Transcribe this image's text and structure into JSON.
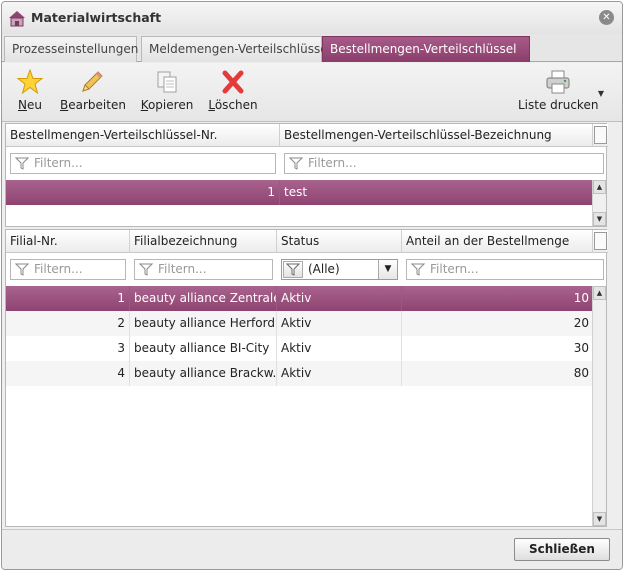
{
  "window": {
    "title": "Materialwirtschaft"
  },
  "tabs": [
    {
      "label": "Prozesseinstellungen",
      "active": false
    },
    {
      "label": "Meldemengen-Verteilschlüssel",
      "active": false
    },
    {
      "label": "Bestellmengen-Verteilschlüssel",
      "active": true
    }
  ],
  "toolbar": {
    "new": {
      "icon": "star-icon",
      "label_u": "N",
      "label_rest": "eu"
    },
    "edit": {
      "icon": "pencil-icon",
      "label_u": "B",
      "label_rest": "earbeiten"
    },
    "copy": {
      "icon": "copy-icon",
      "label_u": "K",
      "label_rest": "opieren"
    },
    "delete": {
      "icon": "delete-x-icon",
      "label_u": "L",
      "label_rest": "öschen"
    },
    "print": {
      "icon": "printer-icon",
      "label": "Liste drucken"
    }
  },
  "keys_grid": {
    "columns": [
      "Bestellmengen-Verteilschlüssel-Nr.",
      "Bestellmengen-Verteilschlüssel-Bezeichnung"
    ],
    "filter_placeholder": "Filtern...",
    "rows": [
      {
        "nr": "1",
        "name": "test",
        "selected": true
      }
    ]
  },
  "branches_grid": {
    "columns": [
      "Filial-Nr.",
      "Filialbezeichnung",
      "Status",
      "Anteil an der Bestellmenge"
    ],
    "filter_placeholder": "Filtern...",
    "status_filter": "(Alle)",
    "rows": [
      {
        "nr": "1",
        "name": "beauty alliance Zentrale",
        "status": "Aktiv",
        "share": "10"
      },
      {
        "nr": "2",
        "name": "beauty alliance Herford",
        "status": "Aktiv",
        "share": "20"
      },
      {
        "nr": "3",
        "name": "beauty alliance BI-City",
        "status": "Aktiv",
        "share": "30"
      },
      {
        "nr": "4",
        "name": "beauty alliance Brackw...",
        "status": "Aktiv",
        "share": "80"
      }
    ]
  },
  "footer": {
    "close_label": "Schließen"
  },
  "colors": {
    "accent": "#8e4470",
    "accent_light": "#a8638e"
  }
}
